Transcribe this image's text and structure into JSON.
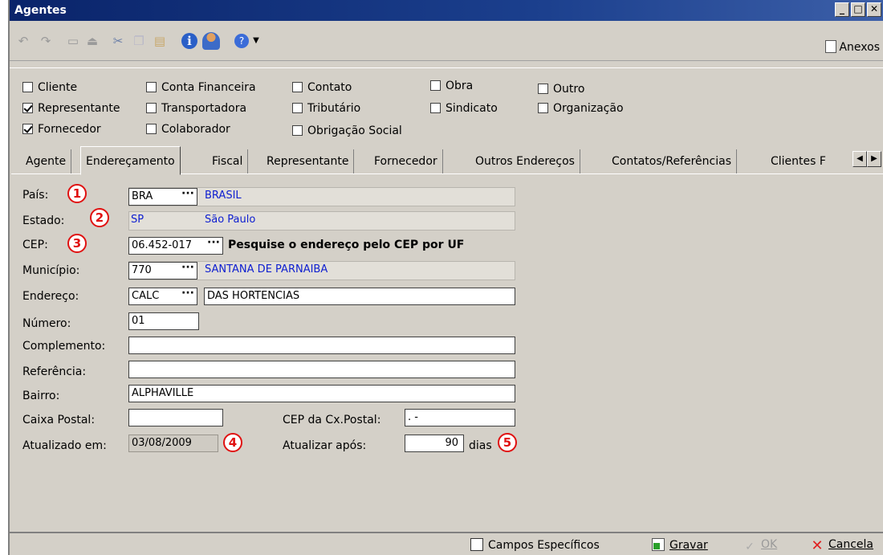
{
  "window": {
    "title": "Agentes",
    "min": "_",
    "max": "□",
    "close": "✕"
  },
  "toolbar": {
    "anexos": "Anexos"
  },
  "types": [
    {
      "label": "Cliente",
      "checked": false
    },
    {
      "label": "Representante",
      "checked": true
    },
    {
      "label": "Fornecedor",
      "checked": true
    },
    {
      "label": "Conta Financeira",
      "checked": false
    },
    {
      "label": "Transportadora",
      "checked": false
    },
    {
      "label": "Colaborador",
      "checked": false
    },
    {
      "label": "Contato",
      "checked": false
    },
    {
      "label": "Tributário",
      "checked": false
    },
    {
      "label": "Obrigação Social",
      "checked": false
    },
    {
      "label": "Obra",
      "checked": false
    },
    {
      "label": "Sindicato",
      "checked": false
    },
    {
      "label": "Outro",
      "checked": false
    },
    {
      "label": "Organização",
      "checked": false
    }
  ],
  "tabs": [
    {
      "label": "Agente"
    },
    {
      "label": "Endereçamento",
      "active": true
    },
    {
      "label": "Fiscal"
    },
    {
      "label": "Representante"
    },
    {
      "label": "Fornecedor"
    },
    {
      "label": "Outros Endereços"
    },
    {
      "label": "Contatos/Referências"
    },
    {
      "label": "Clientes F"
    }
  ],
  "form": {
    "pais": {
      "label": "País:",
      "code": "BRA",
      "name": "BRASIL",
      "badge": "1"
    },
    "estado": {
      "label": "Estado:",
      "code": "SP",
      "name": "São Paulo",
      "badge": "2"
    },
    "cep": {
      "label": "CEP:",
      "value": "06.452-017",
      "hint": "Pesquise o endereço pelo CEP por UF",
      "badge": "3"
    },
    "municipio": {
      "label": "Município:",
      "code": "770",
      "name": "SANTANA DE PARNAIBA"
    },
    "endereco": {
      "label": "Endereço:",
      "code": "CALC",
      "name": "DAS HORTENCIAS"
    },
    "numero": {
      "label": "Número:",
      "value": "01"
    },
    "complemento": {
      "label": "Complemento:",
      "value": ""
    },
    "referencia": {
      "label": "Referência:",
      "value": ""
    },
    "bairro": {
      "label": "Bairro:",
      "value": "ALPHAVILLE"
    },
    "caixa_postal": {
      "label": "Caixa Postal:",
      "value": ""
    },
    "cep_cx": {
      "label": "CEP da Cx.Postal:",
      "value": " .   -"
    },
    "atualizado": {
      "label": "Atualizado em:",
      "value": "03/08/2009",
      "badge": "4"
    },
    "atualizar": {
      "label": "Atualizar após:",
      "value": "90",
      "unit": "dias",
      "badge": "5"
    },
    "ellipsis": "···"
  },
  "statusbar": {
    "campos": "Campos Específicos",
    "gravar": "Gravar",
    "ok": "OK",
    "cancela": "Cancela"
  }
}
